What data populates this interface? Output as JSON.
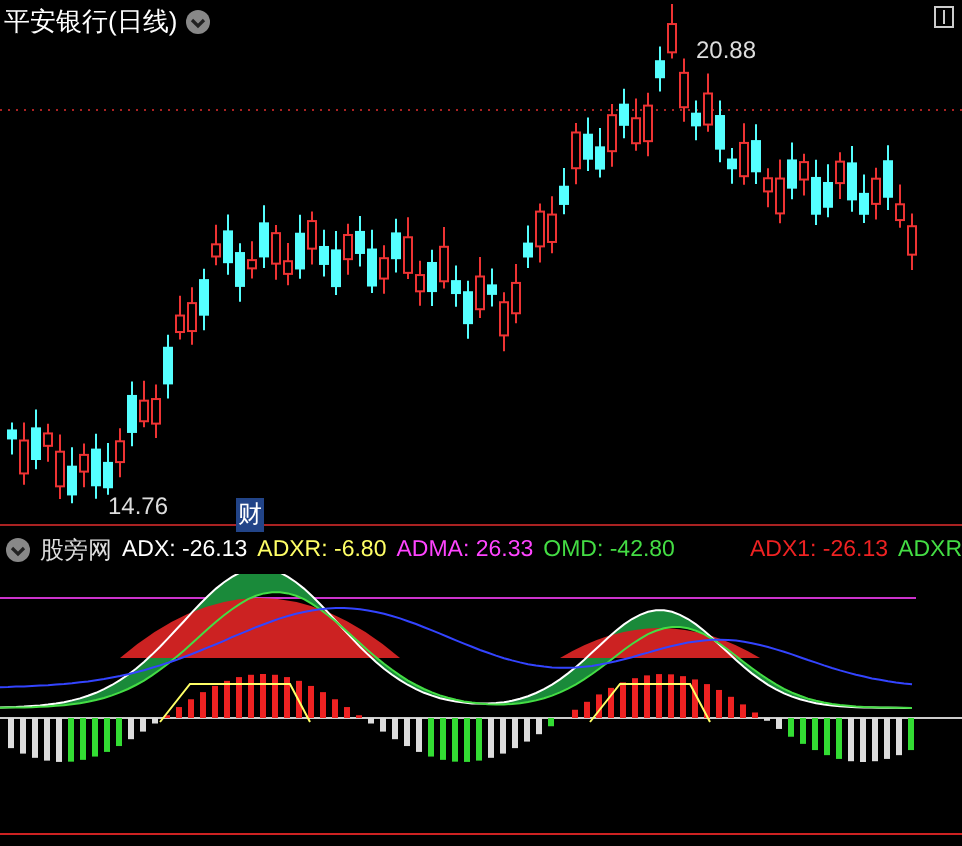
{
  "title": "平安银行(日线)",
  "price_labels": [
    {
      "kind": "high",
      "text": "20.88"
    },
    {
      "kind": "low",
      "text": "14.76"
    }
  ],
  "event_marker": "财",
  "indicator": {
    "name": "股旁网",
    "values": [
      {
        "text": "ADX: -26.13",
        "color": "#ffffff"
      },
      {
        "text": "ADXR: -6.80",
        "color": "#ffff66"
      },
      {
        "text": "ADMA: 26.33",
        "color": "#ff44ff"
      },
      {
        "text": "OMD: -42.80",
        "color": "#44dd44"
      }
    ],
    "right_values": [
      {
        "text": "ADX1: -26.13",
        "color": "#ee2222"
      },
      {
        "text": "ADXR",
        "color": "#44dd44"
      }
    ]
  }
}
